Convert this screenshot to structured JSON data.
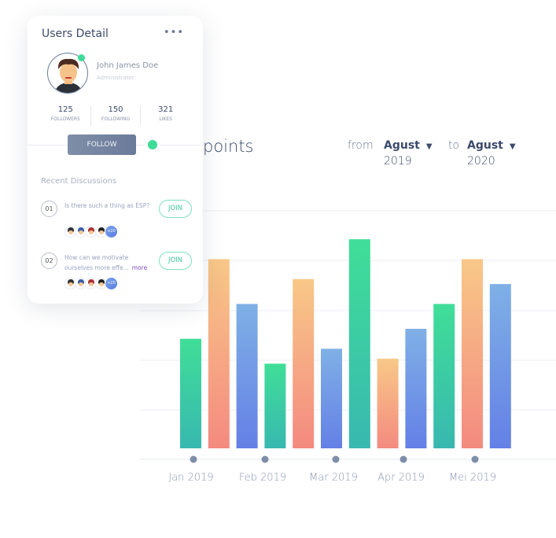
{
  "header": {
    "title_partial": "points",
    "from_label": "from",
    "from_month": "Agust",
    "from_year": "2019",
    "to_label": "to",
    "to_month": "Agust",
    "to_year": "2020"
  },
  "chart_data": {
    "type": "bar",
    "categories": [
      "Jan 2019",
      "Feb 2019",
      "Mar 2019",
      "Apr 2019",
      "Mei 2019"
    ],
    "bar_values": [
      2.2,
      3.8,
      2.9,
      1.7,
      3.4,
      2.0,
      4.2,
      1.8,
      2.4,
      2.9,
      3.8,
      3.3
    ],
    "bar_colors": [
      "green",
      "orange",
      "blue",
      "green",
      "orange",
      "blue",
      "green",
      "orange",
      "blue",
      "green",
      "orange",
      "blue"
    ],
    "gradients": {
      "green": [
        "#40de98",
        "#38b8b0"
      ],
      "orange": [
        "#f8c888",
        "#f48a80"
      ],
      "blue": [
        "#7fb0e6",
        "#6480e6"
      ]
    },
    "ylim": [
      0,
      5
    ],
    "grid": true,
    "y_tick_labels_shown": false
  },
  "card": {
    "title": "Users Detail",
    "menu_icon": "more-horizontal-icon",
    "user": {
      "name": "John James Doe",
      "role": "Administrator",
      "online": true
    },
    "stats": [
      {
        "value": "125",
        "label": "FOLLOWERS"
      },
      {
        "value": "150",
        "label": "FOLLOWING"
      },
      {
        "value": "321",
        "label": "LIKES"
      }
    ],
    "follow_label": "FOLLOW",
    "recent_title": "Recent Discussions",
    "discussions": [
      {
        "num": "01",
        "text": "Is there such a thing as ESP?",
        "more": "",
        "join": "JOIN",
        "extra": "+20"
      },
      {
        "num": "02",
        "text": "How can we motivate ourselves more effe...",
        "more": "more",
        "join": "JOIN",
        "extra": "+20"
      }
    ]
  },
  "colors": {
    "accent": "#3ddc97",
    "text": "#3c4a6b",
    "more": "#7b4fc4"
  }
}
